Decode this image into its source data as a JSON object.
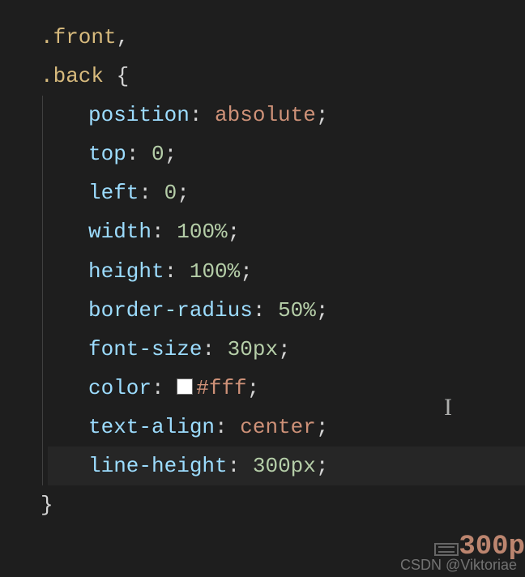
{
  "code": {
    "selector1": ".front",
    "selector2": ".back",
    "brace_open": "{",
    "brace_close": "}",
    "comma": ",",
    "colon": ":",
    "semicolon": ";",
    "declarations": [
      {
        "property": "position",
        "value": "absolute",
        "type": "keyword"
      },
      {
        "property": "top",
        "value": "0",
        "type": "number"
      },
      {
        "property": "left",
        "value": "0",
        "type": "number"
      },
      {
        "property": "width",
        "value": "100%",
        "type": "number"
      },
      {
        "property": "height",
        "value": "100%",
        "type": "number"
      },
      {
        "property": "border-radius",
        "value": "50%",
        "type": "number"
      },
      {
        "property": "font-size",
        "value": "30px",
        "type": "number"
      },
      {
        "property": "color",
        "value": "#fff",
        "type": "color",
        "swatch": "#fff"
      },
      {
        "property": "text-align",
        "value": "center",
        "type": "keyword"
      },
      {
        "property": "line-height",
        "value": "300px",
        "type": "number"
      }
    ]
  },
  "hint_partial": "300p",
  "watermark": "CSDN @Viktoriae"
}
